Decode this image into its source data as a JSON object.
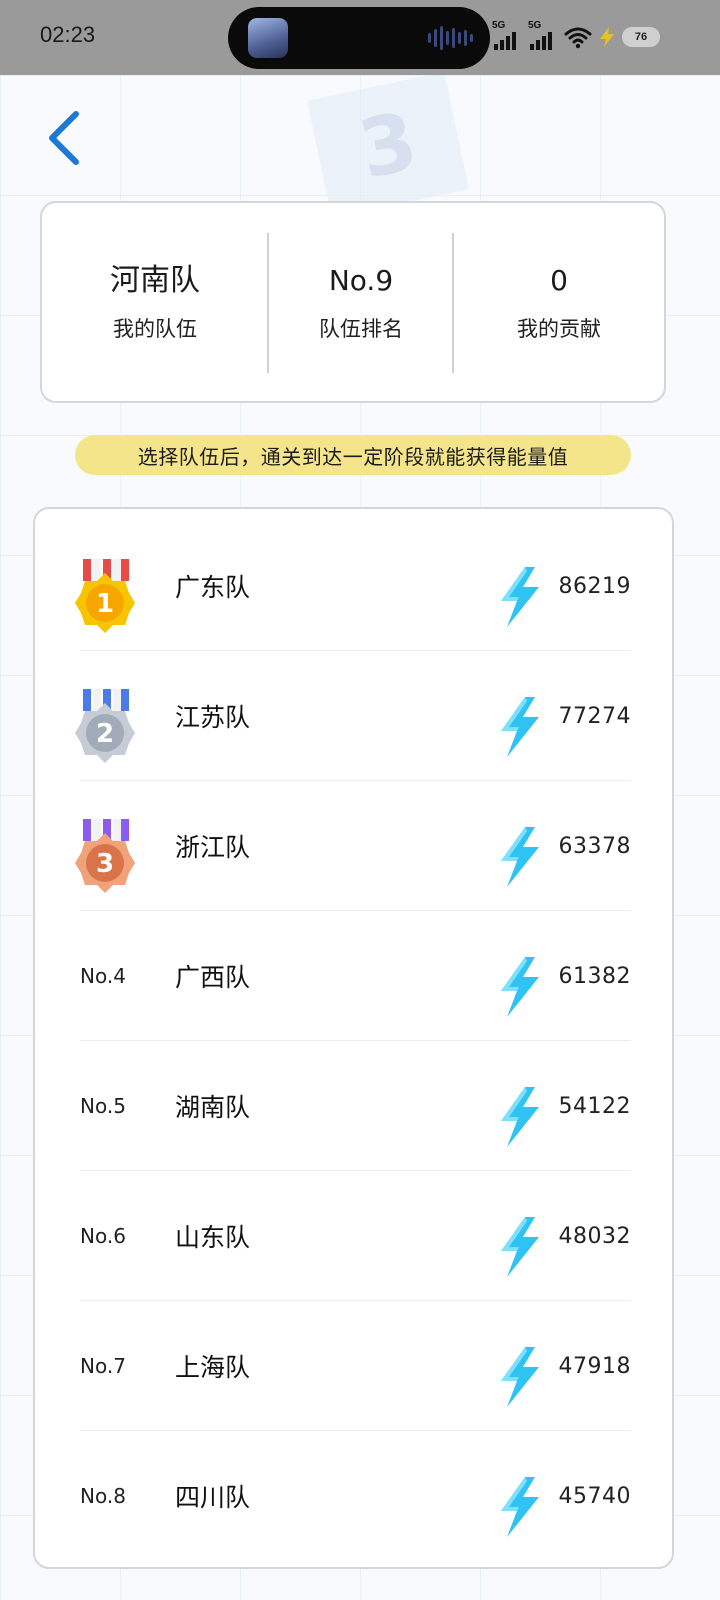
{
  "status_bar": {
    "time": "02:23",
    "signal1_label": "5G",
    "signal2_label": "5G",
    "battery": "76"
  },
  "summary": {
    "team_name": "河南队",
    "team_label": "我的队伍",
    "rank_value": "No.9",
    "rank_label": "队伍排名",
    "contribution_value": "0",
    "contribution_label": "我的贡献"
  },
  "notice": "选择队伍后，通关到达一定阶段就能获得能量值",
  "leaderboard": [
    {
      "rank": "1",
      "name": "广东队",
      "score": "86219"
    },
    {
      "rank": "2",
      "name": "江苏队",
      "score": "77274"
    },
    {
      "rank": "3",
      "name": "浙江队",
      "score": "63378"
    },
    {
      "rank": "No.4",
      "name": "广西队",
      "score": "61382"
    },
    {
      "rank": "No.5",
      "name": "湖南队",
      "score": "54122"
    },
    {
      "rank": "No.6",
      "name": "山东队",
      "score": "48032"
    },
    {
      "rank": "No.7",
      "name": "上海队",
      "score": "47918"
    },
    {
      "rank": "No.8",
      "name": "四川队",
      "score": "45740"
    }
  ],
  "colors": {
    "accent_blue": "#1a78d6",
    "notice_yellow": "#f5e58a",
    "bolt_blue": "#2fc3f3",
    "gold": "#f7b500",
    "silver": "#a9b2bf",
    "bronze": "#e08a5c"
  },
  "icons": {
    "back": "chevron-left-icon",
    "energy": "lightning-bolt-icon"
  }
}
